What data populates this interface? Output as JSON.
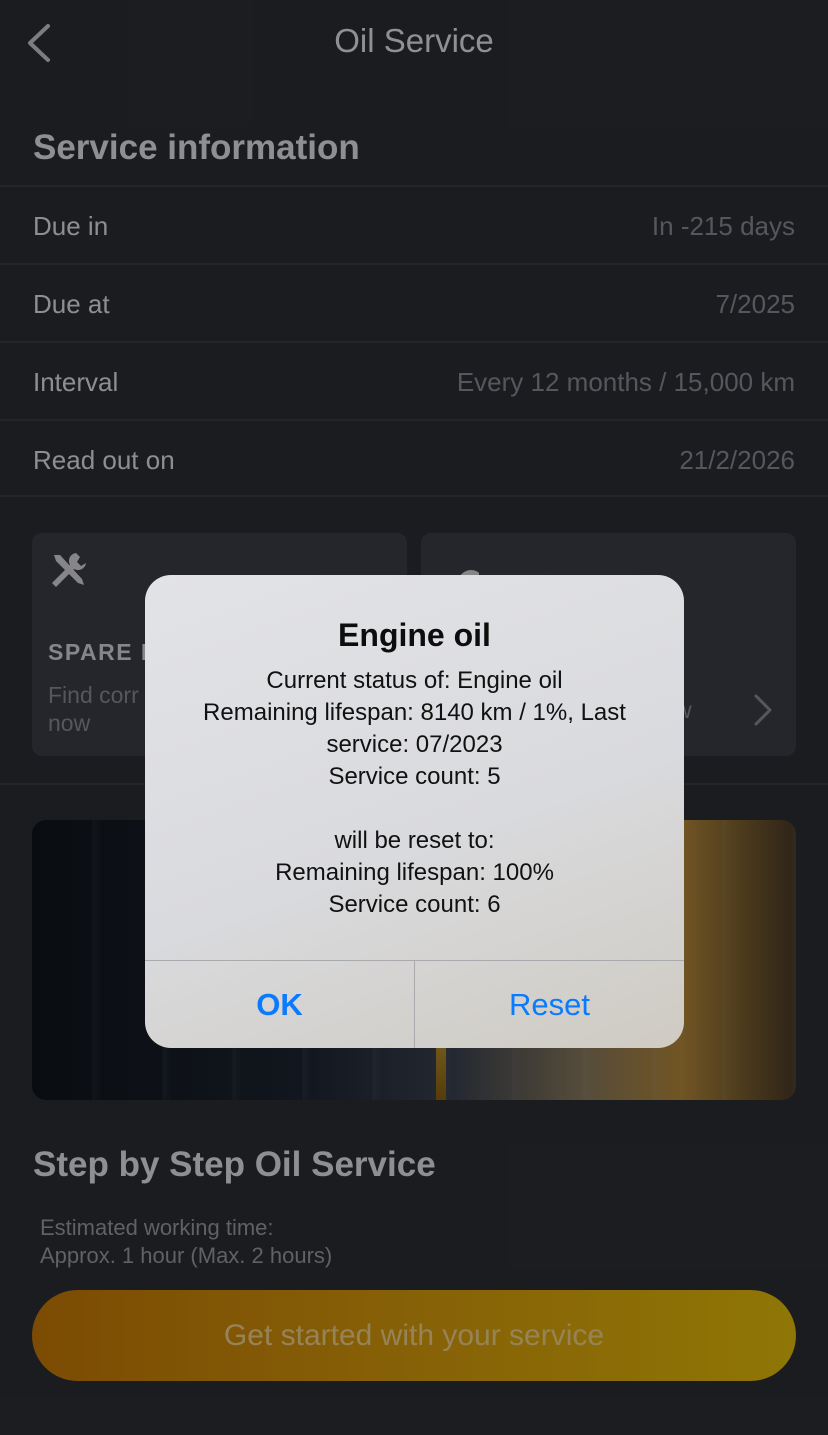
{
  "nav": {
    "title": "Oil Service",
    "back_icon": "chevron-left-icon"
  },
  "service_info": {
    "title": "Service information",
    "rows": [
      {
        "label": "Due in",
        "value": "In -215 days"
      },
      {
        "label": "Due at",
        "value": "7/2025"
      },
      {
        "label": "Interval",
        "value": "Every 12 months / 15,000 km"
      },
      {
        "label": "Read out on",
        "value": "21/2/2026"
      }
    ]
  },
  "cards": {
    "spare": {
      "icon": "tools-icon",
      "title": "SPARE P",
      "desc_line1": "Find corr",
      "desc_line2": "now"
    },
    "second": {
      "icon": "gear-icon",
      "desc_fragment": "w",
      "chevron": "chevron-right-icon"
    }
  },
  "steps": {
    "title": "Step by Step Oil Service",
    "est_line1": "Estimated working time:",
    "est_line2": "Approx. 1 hour (Max. 2 hours)",
    "cta": "Get started with your service"
  },
  "alert": {
    "title": "Engine oil",
    "line1": "Current status of: Engine oil",
    "line2": "Remaining lifespan: 8140 km / 1%, Last",
    "line3": "service: 07/2023",
    "line4": "Service count: 5",
    "line5": "will be reset to:",
    "line6": "Remaining lifespan: 100%",
    "line7": "Service count: 6",
    "ok": "OK",
    "reset": "Reset"
  },
  "colors": {
    "background": "#2b2e35",
    "accent": "#0a7aff",
    "cta_start": "#c77a06",
    "cta_end": "#e7bf0a"
  }
}
